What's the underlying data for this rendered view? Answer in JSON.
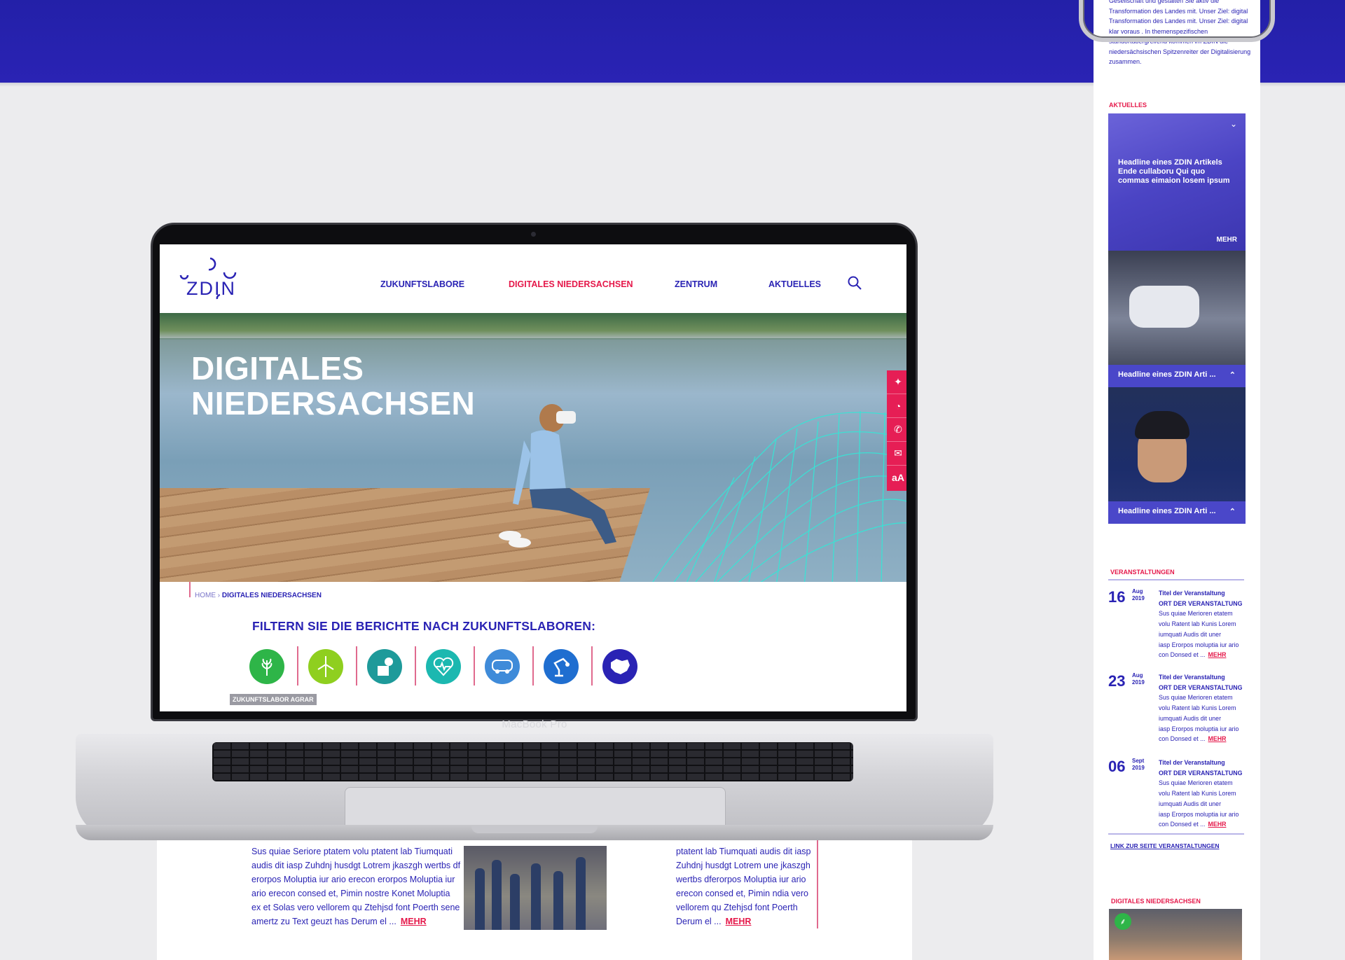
{
  "brand": {
    "logo": "ZDIN",
    "colors": {
      "primary": "#2a23b4",
      "accent": "#e5184a",
      "teal": "#1e9a9a"
    }
  },
  "nav": {
    "items": [
      "ZUKUNFTSLABORE",
      "DIGITALES NIEDERSACHSEN",
      "ZENTRUM",
      "AKTUELLES"
    ],
    "active": "DIGITALES NIEDERSACHSEN"
  },
  "hero": {
    "title_line1": "DIGITALES",
    "title_line2": "NIEDERSACHSEN"
  },
  "social": [
    "twitter-icon",
    "rss-icon",
    "phone-icon",
    "mail-icon",
    "font-size-icon"
  ],
  "breadcrumb": {
    "home": "HOME",
    "current": "DIGITALES NIEDERSACHSEN"
  },
  "filter": {
    "heading": "FILTERN SIE DIE BERICHTE NACH ZUKUNFTSLABOREN:",
    "tooltip": "ZUKUNFTSLABOR AGRAR",
    "icons": [
      {
        "name": "agrar-icon",
        "color": "#2eb548"
      },
      {
        "name": "energie-icon",
        "color": "#8fcf1f"
      },
      {
        "name": "produktion-icon",
        "color": "#1e9a9a"
      },
      {
        "name": "gesundheit-icon",
        "color": "#1cb8b0"
      },
      {
        "name": "mobilitaet-icon",
        "color": "#3f8bd9"
      },
      {
        "name": "robotik-icon",
        "color": "#1f6ed0"
      },
      {
        "name": "gesellschaft-icon",
        "color": "#2a23b4"
      }
    ]
  },
  "laptop": {
    "label": "MacBook Pro"
  },
  "below": {
    "col1": [
      "Sus quiae Seriore ptatem volu ptatent lab Tiumquati",
      "audis dit iasp Zuhdnj husdgt Lotrem jkaszgh wertbs df",
      "erorpos Moluptia iur ario  erecon erorpos Moluptia iur",
      "ario  erecon consed et, Pimin nostre Konet Moluptia",
      "ex et Solas vero vellorem qu Ztehjsd font Poerth sene",
      "amertz zu Text geuzt has Derum el ..."
    ],
    "col3": [
      "ptatent lab Tiumquati audis dit iasp",
      "Zuhdnj husdgt Lotrem une jkaszgh",
      "wertbs dferorpos Moluptia iur ario",
      "erecon consed et, Pimin ndia vero",
      "vellorem qu Ztehjsd font Poerth",
      "Derum el ..."
    ],
    "more": "MEHR"
  },
  "mobile": {
    "intro": [
      "Gesellschaft und gestalten Sie aktiv die",
      "Transformation des Landes mit. Unser Ziel: digital",
      "Transformation des Landes mit. Unser Ziel: digital",
      "klar voraus . In themenspezifischen",
      "standortübergreifend kommen im ZDIN die",
      "niedersächsischen Spitzenreiter der Digitalisierung",
      "zusammen."
    ],
    "aktuelles_label": "AKTUELLES",
    "featured": {
      "headline": "Headline eines ZDIN Artikels Ende cullaboru Qui quo commas eimaion losem ipsum",
      "more": "MEHR"
    },
    "cards": [
      "Headline eines ZDIN Arti ...",
      "Headline eines ZDIN Arti ..."
    ],
    "events_label": "VERANSTALTUNGEN",
    "events": [
      {
        "day": "16",
        "month": "Aug",
        "year": "2019",
        "title": "Titel der Veranstaltung",
        "place": "ORT DER VERANSTALTUNG",
        "lines": [
          "Sus quiae Merioren etatem",
          "volu Ratent lab Kunis Lorem",
          "iumquati Audis dit uner",
          "iasp Erorpos moluptia iur ario",
          "con Donsed et ..."
        ]
      },
      {
        "day": "23",
        "month": "Aug",
        "year": "2019",
        "title": "Titel der Veranstaltung",
        "place": "ORT DER VERANSTALTUNG",
        "lines": [
          "Sus quiae Merioren etatem",
          "volu Ratent lab Kunis Lorem",
          "iumquati Audis dit uner",
          "iasp Erorpos moluptia iur ario",
          "con Donsed et ..."
        ]
      },
      {
        "day": "06",
        "month": "Sept",
        "year": "2019",
        "title": "Titel der Veranstaltung",
        "place": "ORT DER VERANSTALTUNG",
        "lines": [
          "Sus quiae Merioren etatem",
          "volu Ratent lab Kunis Lorem",
          "iumquati Audis dit uner",
          "iasp Erorpos moluptia iur ario",
          "con Donsed et ..."
        ]
      }
    ],
    "events_more": "MEHR",
    "events_link": "LINK ZUR SEITE VERANSTALTUNGEN",
    "dn_label": "DIGITALES NIEDERSACHSEN"
  }
}
